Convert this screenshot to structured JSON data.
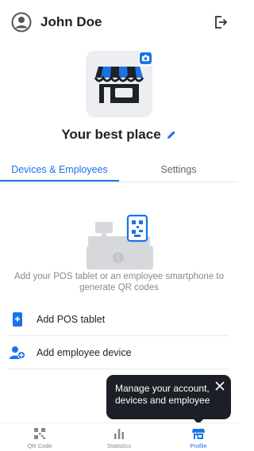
{
  "header": {
    "user_name": "John Doe"
  },
  "shop": {
    "name": "Your best place"
  },
  "tabs": [
    {
      "label": "Devices & Employees",
      "active": true
    },
    {
      "label": "Settings",
      "active": false
    }
  ],
  "empty_state": {
    "hint": "Add your POS tablet or an employee smartphone to generate QR codes"
  },
  "actions": [
    {
      "label": "Add POS tablet",
      "icon": "tablet-add-icon"
    },
    {
      "label": "Add employee device",
      "icon": "person-add-icon"
    }
  ],
  "tooltip": {
    "text": "Manage your account, devices and employee"
  },
  "bottom_nav": [
    {
      "label": "QR Code",
      "icon": "qr-icon",
      "active": false
    },
    {
      "label": "Statistics",
      "icon": "bar-chart-icon",
      "active": false
    },
    {
      "label": "Profile",
      "icon": "shop-icon",
      "active": true
    }
  ],
  "colors": {
    "accent": "#1a73e8",
    "tooltip_bg": "#1c2026",
    "muted": "#8a8a8a"
  }
}
